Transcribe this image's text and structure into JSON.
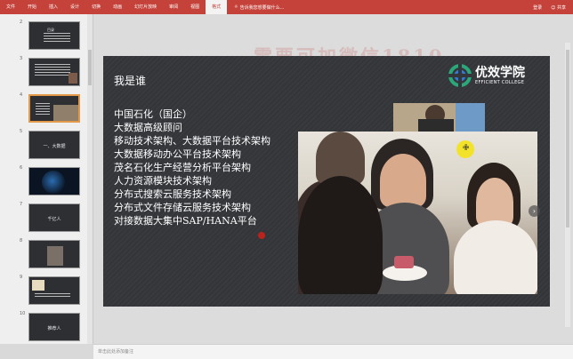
{
  "ribbon": {
    "tabs": [
      "文件",
      "开始",
      "插入",
      "设计",
      "切换",
      "动画",
      "幻灯片放映",
      "审阅",
      "视图",
      "格式"
    ],
    "active_tab": "格式",
    "tell_me": "告诉我您想要做什么...",
    "login": "登录",
    "share": "共享"
  },
  "watermark": "需要可加微信1810",
  "thumbnails": [
    {
      "num": "2",
      "title": "目录",
      "active": false
    },
    {
      "num": "3",
      "title": "",
      "active": false
    },
    {
      "num": "4",
      "title": "",
      "active": true
    },
    {
      "num": "5",
      "title": "一、大数据",
      "active": false
    },
    {
      "num": "6",
      "title": "",
      "active": false
    },
    {
      "num": "7",
      "title": "千亿人",
      "active": false
    },
    {
      "num": "8",
      "title": "",
      "active": false
    },
    {
      "num": "9",
      "title": "",
      "active": false
    },
    {
      "num": "10",
      "title": "推荐人",
      "active": false
    }
  ],
  "slide": {
    "title": "我是谁",
    "logo": {
      "name": "优效学院",
      "sub": "EFFICIENT COLLEGE",
      "accent": "#2aa87a"
    },
    "bio": [
      "中国石化（国企）",
      "大数据高级顾问",
      "移动技术架构、大数据平台技术架构",
      "大数据移动办公平台技术架构",
      "茂名石化生产经营分析平台架构",
      "人力资源模块技术架构",
      "分布式搜索云服务技术架构",
      "分布式文件存储云服务技术架构",
      "对接数据大集中SAP/HANA平台"
    ],
    "cursor_icon": "pointer-icon"
  },
  "notes": "单击此处添加备注"
}
